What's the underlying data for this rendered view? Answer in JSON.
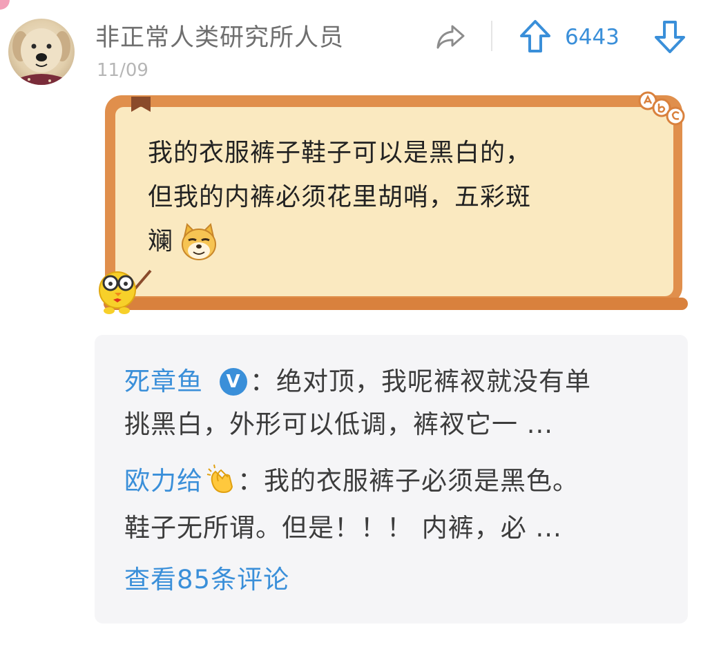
{
  "post": {
    "author": "非正常人类研究所人员",
    "date": "11/09",
    "vote_count": "6443",
    "content_line1": "我的衣服裤子鞋子可以是黑白的，",
    "content_line2": "但我的内裤必须花里胡哨，五彩斑",
    "content_line3": "斓"
  },
  "icons": {
    "share": "share-arrow-icon",
    "upvote": "arrow-up-icon",
    "downvote": "arrow-down-icon",
    "emoji": "doge-shiba-emoji",
    "verified": "v-badge-icon",
    "clap": "clapping-hands-emoji"
  },
  "comments": [
    {
      "user": "死章鱼",
      "verified_mark": "V",
      "sep": "：",
      "text_line1": "绝对顶，我呢裤衩就没有单",
      "text_line2": "挑黑白，外形可以低调，裤衩它一 ..."
    },
    {
      "user": "欧力给",
      "sep": "：",
      "text_line1": "我的衣服裤子必须是黑色。",
      "text_line2": "鞋子无所谓。但是！！！ 内裤，必 ..."
    }
  ],
  "view_comments_label": "查看85条评论",
  "colors": {
    "accent_blue": "#3a8fd9",
    "board_orange": "#e08f4c",
    "board_cream": "#fae9c0",
    "comment_bg": "#f5f5f7"
  }
}
